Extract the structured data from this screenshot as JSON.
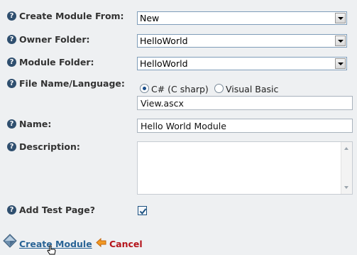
{
  "help_icon_glyph": "?",
  "create_module_from": {
    "label": "Create Module From:",
    "value": "New"
  },
  "owner_folder": {
    "label": "Owner Folder:",
    "value": "HelloWorld"
  },
  "module_folder": {
    "label": "Module Folder:",
    "value": "HelloWorld"
  },
  "file_name_language": {
    "label": "File Name/Language:",
    "options": [
      {
        "label": "C# (C sharp)",
        "checked": true
      },
      {
        "label": "Visual Basic",
        "checked": false
      }
    ],
    "file_name": "View.ascx"
  },
  "name": {
    "label": "Name:",
    "value": "Hello World Module"
  },
  "description": {
    "label": "Description:",
    "value": ""
  },
  "add_test_page": {
    "label": "Add Test Page?",
    "checked": true
  },
  "actions": {
    "create_label": "Create Module",
    "cancel_label": "Cancel"
  },
  "icons": {
    "help": "help-icon",
    "create": "module-diamond-icon",
    "cancel": "back-arrow-icon",
    "cursor": "hand-cursor-icon",
    "dropdown": "chevron-down-icon"
  },
  "colors": {
    "background": "#eef0f2",
    "label_text": "#333333",
    "link_blue": "#2a6496",
    "cancel_red": "#b5141b",
    "help_icon": "#2f4f6f"
  }
}
